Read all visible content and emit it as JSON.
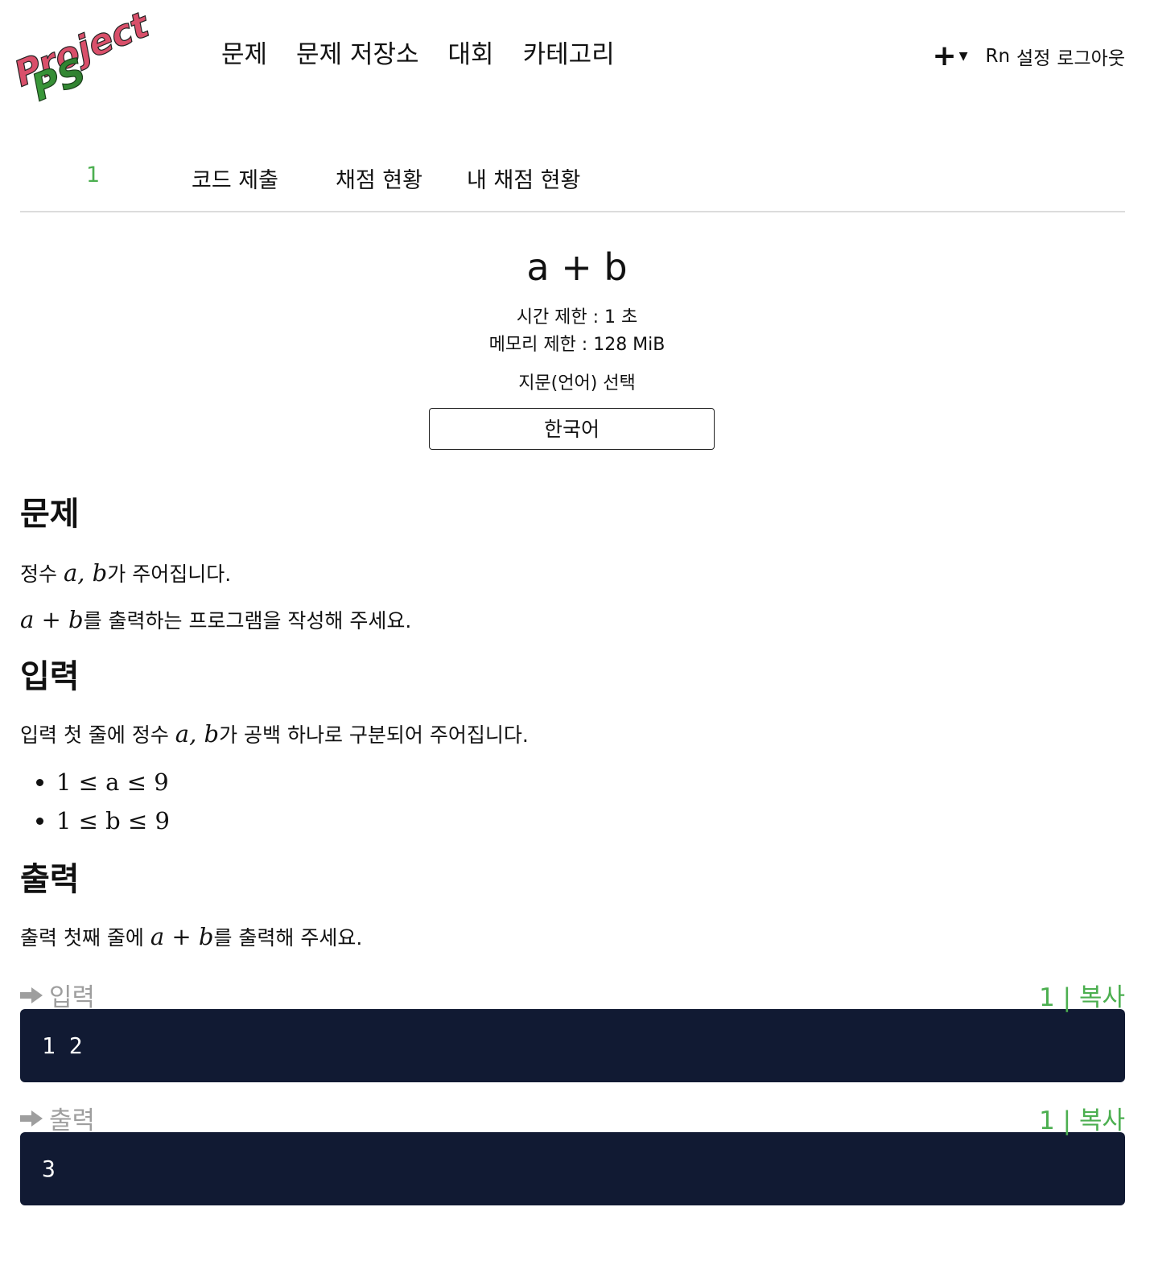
{
  "header": {
    "logo_text_top": "Project",
    "logo_text_bottom": "PS",
    "nav": [
      "문제",
      "문제 저장소",
      "대회",
      "카테고리"
    ],
    "plus_label": "+",
    "user_links": [
      "Rn",
      "설정",
      "로그아웃"
    ]
  },
  "subtabs": [
    "1",
    "코드 제출",
    "채점 현황",
    "내 채점 현황"
  ],
  "problem": {
    "title": "a + b",
    "time_limit": "시간 제한 : 1 초",
    "memory_limit": "메모리 제한 : 128 MiB",
    "language_label": "지문(언어) 선택",
    "language_selected": "한국어"
  },
  "sections": {
    "statement_title": "문제",
    "statement_1_pre": "정수 ",
    "statement_1_math": "a, b",
    "statement_1_post": "가 주어집니다.",
    "statement_2_math": "a + b",
    "statement_2_post": "를 출력하는 프로그램을 작성해 주세요.",
    "input_title": "입력",
    "input_pre": "입력 첫 줄에 정수 ",
    "input_math": "a, b",
    "input_post": "가 공백 하나로 구분되어 주어집니다.",
    "constraints": [
      "1 ≤ a ≤ 9",
      "1 ≤ b ≤ 9"
    ],
    "output_title": "출력",
    "output_pre": "출력 첫째 줄에 ",
    "output_math": "a + b",
    "output_post": "를 출력해 주세요."
  },
  "samples": {
    "input_label": "입력",
    "input_copy": "1 | 복사",
    "input_value": "1 2",
    "output_label": "출력",
    "output_copy": "1 | 복사",
    "output_value": "3"
  },
  "colors": {
    "accent": "#4caf50",
    "sample_bg": "#111a33",
    "muted": "#9e9e9e"
  }
}
